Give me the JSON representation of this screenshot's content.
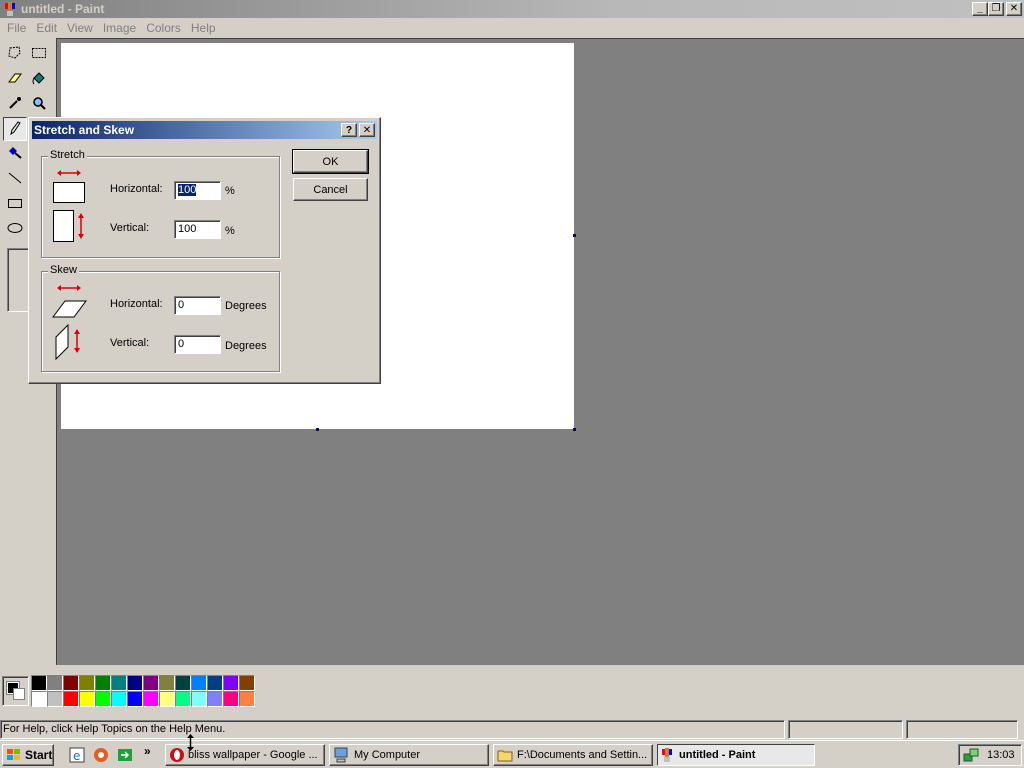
{
  "window": {
    "title": "untitled - Paint",
    "controls": {
      "minimize": "_",
      "restore": "❐",
      "close": "✕"
    }
  },
  "menu": [
    {
      "label": "File"
    },
    {
      "label": "Edit"
    },
    {
      "label": "View"
    },
    {
      "label": "Image"
    },
    {
      "label": "Colors"
    },
    {
      "label": "Help"
    }
  ],
  "tools": [
    {
      "name": "free-form-select",
      "icon": "free-select-icon"
    },
    {
      "name": "select",
      "icon": "rect-select-icon"
    },
    {
      "name": "eraser",
      "icon": "eraser-icon"
    },
    {
      "name": "fill",
      "icon": "fill-bucket-icon"
    },
    {
      "name": "pick-color",
      "icon": "eyedropper-icon"
    },
    {
      "name": "magnifier",
      "icon": "magnifier-icon"
    },
    {
      "name": "pencil",
      "icon": "pencil-icon",
      "selected": true
    },
    {
      "name": "brush",
      "icon": "brush-icon"
    },
    {
      "name": "line",
      "icon": "line-icon"
    },
    {
      "name": "rectangle",
      "icon": "rectangle-icon"
    },
    {
      "name": "ellipse",
      "icon": "ellipse-icon"
    }
  ],
  "palette": {
    "foreground": "#000000",
    "background": "#ffffff",
    "colors": [
      "#000000",
      "#808080",
      "#800000",
      "#808000",
      "#008000",
      "#008080",
      "#000080",
      "#800080",
      "#808040",
      "#004040",
      "#0080ff",
      "#004080",
      "#8000ff",
      "#804000",
      "#ffffff",
      "#c0c0c0",
      "#ff0000",
      "#ffff00",
      "#00ff00",
      "#00ffff",
      "#0000ff",
      "#ff00ff",
      "#ffff80",
      "#00ff80",
      "#80ffff",
      "#8080ff",
      "#ff0080",
      "#ff8040"
    ]
  },
  "status": {
    "help_text": "For Help, click Help Topics on the Help Menu."
  },
  "dialog": {
    "title": "Stretch and Skew",
    "help_button": "?",
    "close_button": "✕",
    "stretch": {
      "group_label": "Stretch",
      "horizontal_label": "Horizontal:",
      "horizontal_value": "100",
      "horizontal_unit": "%",
      "vertical_label": "Vertical:",
      "vertical_value": "100",
      "vertical_unit": "%"
    },
    "skew": {
      "group_label": "Skew",
      "horizontal_label": "Horizontal:",
      "horizontal_value": "0",
      "horizontal_unit": "Degrees",
      "vertical_label": "Vertical:",
      "vertical_value": "0",
      "vertical_unit": "Degrees"
    },
    "ok_label": "OK",
    "cancel_label": "Cancel"
  },
  "taskbar": {
    "start_label": "Start",
    "quick_launch": [
      "ie-icon",
      "browser-icon",
      "show-desktop-icon"
    ],
    "overflow": "»",
    "tasks": [
      {
        "label": "bliss wallpaper - Google ...",
        "icon": "opera-icon"
      },
      {
        "label": "My Computer",
        "icon": "my-computer-icon"
      },
      {
        "label": "F:\\Documents and Settin...",
        "icon": "folder-icon"
      },
      {
        "label": "untitled - Paint",
        "icon": "paint-icon",
        "active": true
      }
    ],
    "clock": "13:03"
  }
}
